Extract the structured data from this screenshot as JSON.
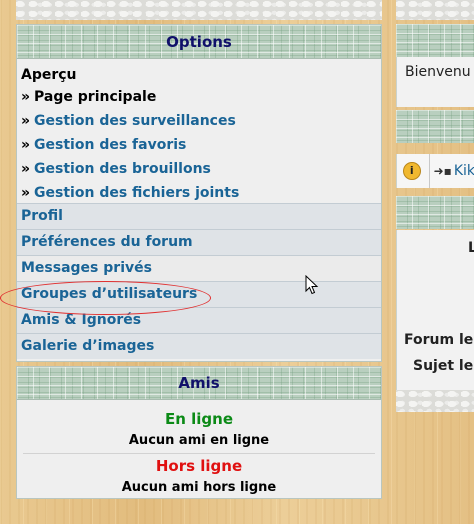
{
  "options_panel": {
    "title": "Options",
    "overview_title": "Aperçu",
    "bullet": "»",
    "overview_items": [
      {
        "label": "Page principale"
      },
      {
        "label": "Gestion des surveillances"
      },
      {
        "label": "Gestion des favoris"
      },
      {
        "label": "Gestion des brouillons"
      },
      {
        "label": "Gestion des fichiers joints"
      }
    ],
    "nav_items": [
      {
        "label": "Profil"
      },
      {
        "label": "Préférences du forum"
      },
      {
        "label": "Messages privés"
      },
      {
        "label": "Groupes d’utilisateurs"
      },
      {
        "label": "Amis & Ignorés"
      },
      {
        "label": "Galerie d’images"
      }
    ]
  },
  "friends_panel": {
    "title": "Amis",
    "online_label": "En ligne",
    "online_text": "Aucun ami en ligne",
    "offline_label": "Hors ligne",
    "offline_text": "Aucun ami hors ligne"
  },
  "right_column": {
    "welcome": "Bienvenu",
    "user_link": "Kik",
    "label_l": "L",
    "forum_label": "Forum le",
    "subject_label": "Sujet le"
  },
  "colors": {
    "link": "#1a6496",
    "header_text": "#10106a",
    "online": "#0b8a16",
    "offline": "#e01010",
    "annotation": "#e03030"
  },
  "icons": [
    "info-icon",
    "login-icon",
    "mouse-cursor-icon"
  ]
}
